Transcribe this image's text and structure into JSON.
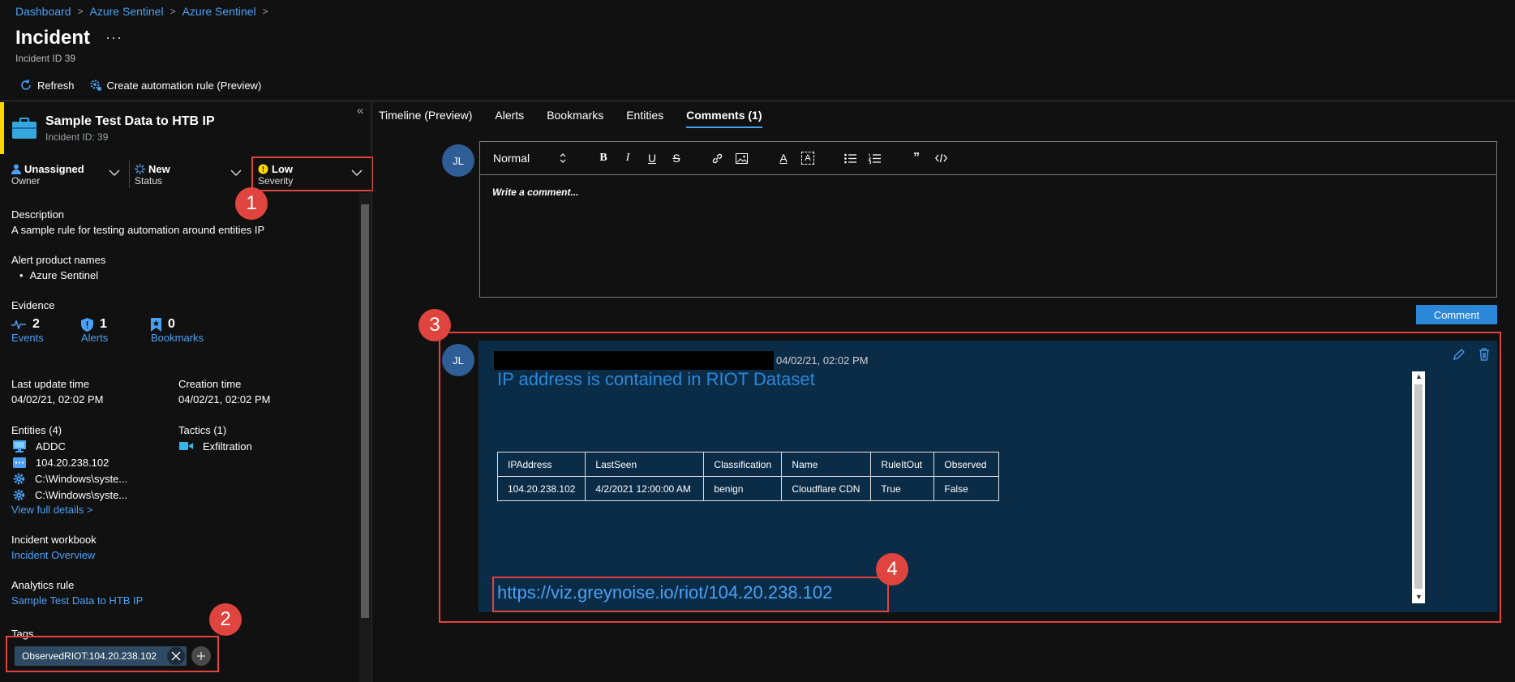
{
  "breadcrumb": [
    "Dashboard",
    "Azure Sentinel",
    "Azure Sentinel"
  ],
  "page": {
    "title": "Incident",
    "subtitle": "Incident ID 39",
    "more": "···"
  },
  "toolbar": {
    "refresh": "Refresh",
    "automation": "Create automation rule (Preview)"
  },
  "incident": {
    "title": "Sample Test Data to HTB IP",
    "id_label": "Incident ID: 39",
    "owner": {
      "value": "Unassigned",
      "label": "Owner"
    },
    "status": {
      "value": "New",
      "label": "Status"
    },
    "severity": {
      "value": "Low",
      "label": "Severity"
    },
    "description_label": "Description",
    "description": "A sample rule for testing automation around entities IP",
    "alert_products_label": "Alert product names",
    "alert_products": [
      "Azure Sentinel"
    ],
    "evidence_label": "Evidence",
    "evidence": [
      {
        "count": "2",
        "label": "Events"
      },
      {
        "count": "1",
        "label": "Alerts"
      },
      {
        "count": "0",
        "label": "Bookmarks"
      }
    ],
    "last_update_label": "Last update time",
    "last_update": "04/02/21, 02:02 PM",
    "creation_label": "Creation time",
    "creation": "04/02/21, 02:02 PM",
    "entities_label": "Entities (4)",
    "entities": [
      "ADDC",
      "104.20.238.102",
      "C:\\Windows\\syste...",
      "C:\\Windows\\syste..."
    ],
    "view_details": "View full details >",
    "tactics_label": "Tactics (1)",
    "tactics": [
      "Exfiltration"
    ],
    "workbook_label": "Incident workbook",
    "workbook": "Incident Overview",
    "rule_label": "Analytics rule",
    "rule": "Sample Test Data to HTB IP",
    "tags_label": "Tags",
    "tags": [
      "ObservedRIOT:104.20.238.102"
    ]
  },
  "tabs": [
    "Timeline (Preview)",
    "Alerts",
    "Bookmarks",
    "Entities",
    "Comments (1)"
  ],
  "editor": {
    "format": "Normal",
    "placeholder": "Write a comment...",
    "submit": "Comment"
  },
  "avatar_initials": "JL",
  "comment": {
    "date": "04/02/21, 02:02 PM",
    "heading": "IP address is contained in RIOT Dataset",
    "table": {
      "headers": [
        "IPAddress",
        "LastSeen",
        "Classification",
        "Name",
        "RuleItOut",
        "Observed"
      ],
      "row": [
        "104.20.238.102",
        "4/2/2021 12:00:00 AM",
        "benign",
        "Cloudflare CDN",
        "True",
        "False"
      ]
    },
    "link": "https://viz.greynoise.io/riot/104.20.238.102"
  },
  "annotations": [
    "1",
    "2",
    "3",
    "4"
  ],
  "colors": {
    "accent": "#4aa0f5",
    "highlight": "#e0443e",
    "card": "#0b2c47",
    "severity_low": "#ffd700"
  }
}
